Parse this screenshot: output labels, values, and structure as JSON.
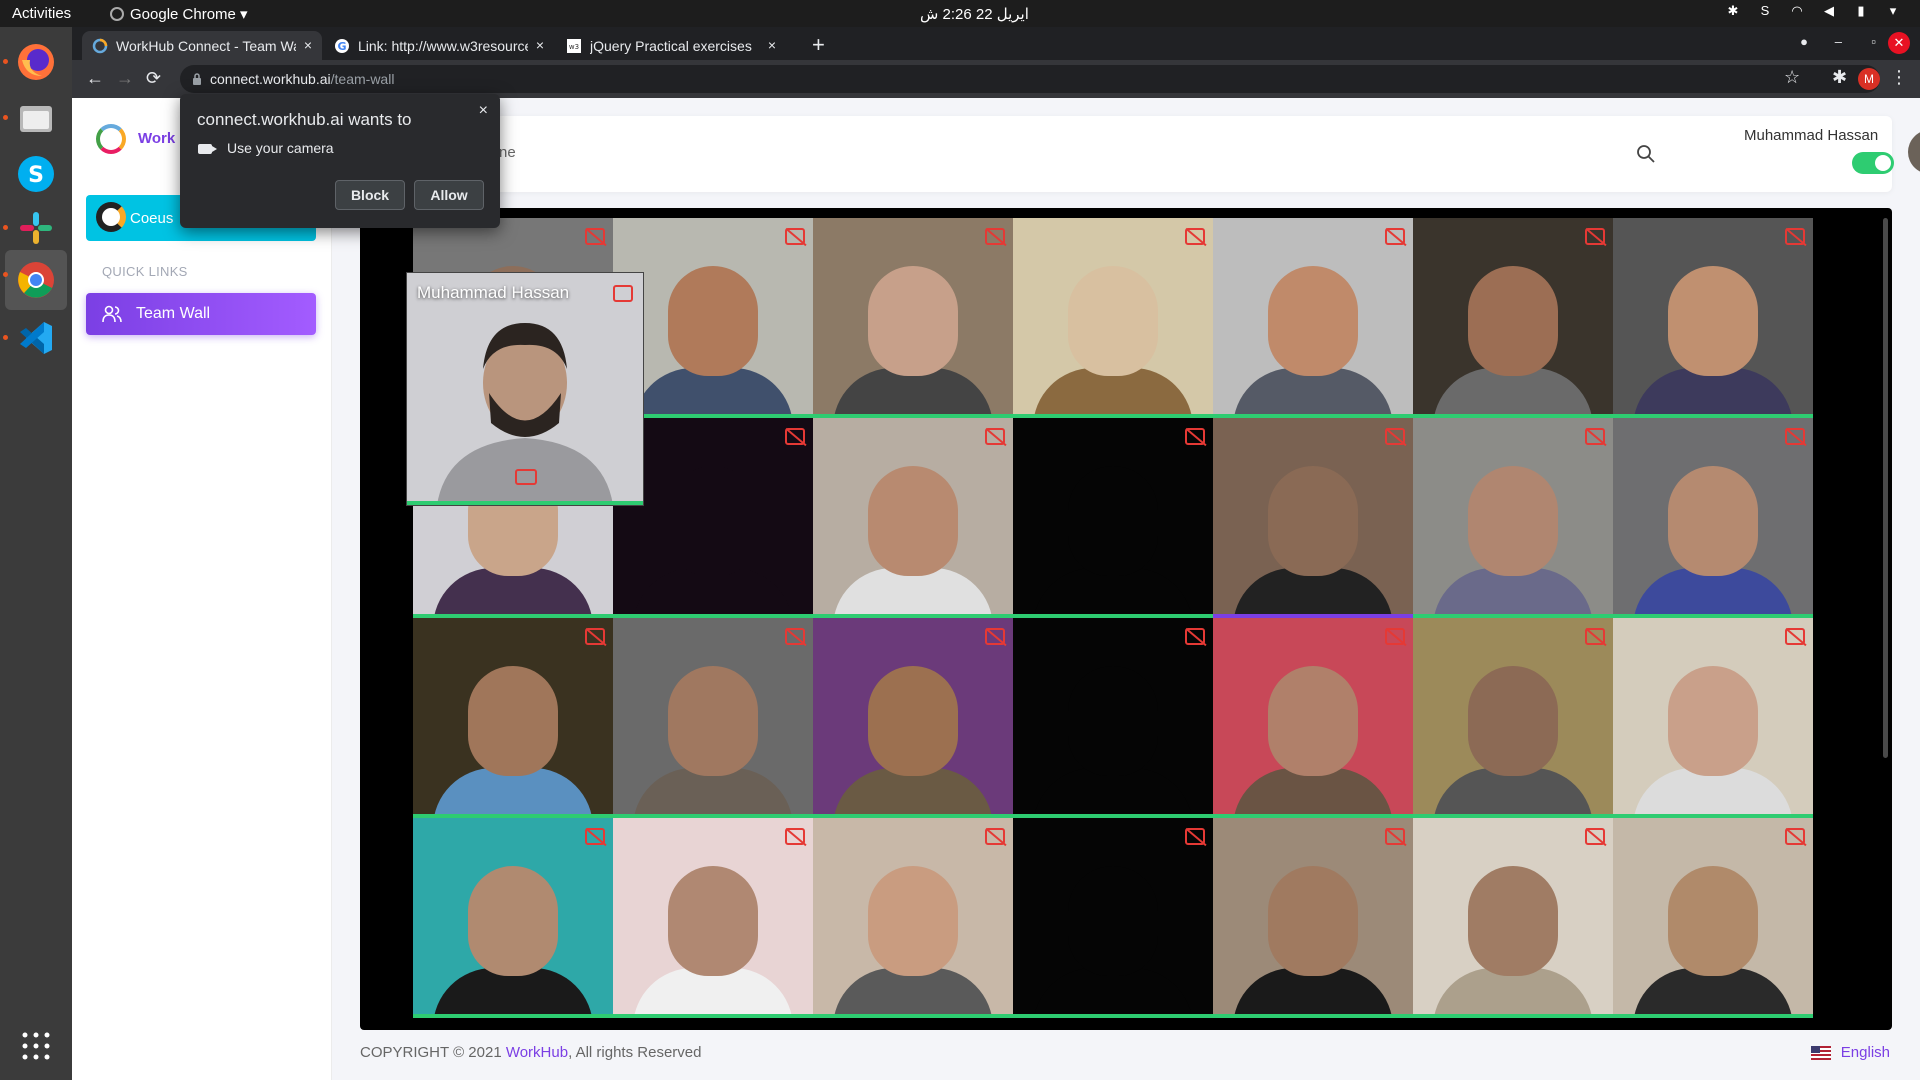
{
  "topbar": {
    "activities": "Activities",
    "app_menu": "Google Chrome ▾",
    "clock": "ایریل 22  2:26 ش"
  },
  "dock": {
    "items": [
      "firefox-icon",
      "files-icon",
      "skype-icon",
      "slack-icon",
      "chrome-icon",
      "vscode-icon",
      "app-grid-icon"
    ]
  },
  "tabs": [
    {
      "title": "WorkHub Connect - Team Wall",
      "close": "×"
    },
    {
      "title": "Link: http://www.w3resource",
      "close": "×"
    },
    {
      "title": "jQuery Practical exercises",
      "close": "×"
    }
  ],
  "new_tab": "+",
  "window_controls": {
    "minimize": "–",
    "maximize": "▫",
    "close": "✕"
  },
  "addressbar": {
    "back": "←",
    "forward": "→",
    "reload": "⟳",
    "host": "connect.workhub.ai",
    "path": "/team-wall",
    "star": "☆",
    "extensions": "✱",
    "profile": "M",
    "menu": "⋮"
  },
  "sidebar": {
    "logo_text": "Work",
    "company": "Coeus",
    "quick_links": "QUICK LINKS",
    "team_wall": "Team Wall"
  },
  "header": {
    "crumb": "ne",
    "user_name": "Muhammad Hassan",
    "toggle_on": true
  },
  "permission_popup": {
    "title": "connect.workhub.ai wants to",
    "request": "Use your camera",
    "block": "Block",
    "allow": "Allow",
    "close": "×"
  },
  "video_wall": {
    "self_name": "Muhammad Hassan",
    "rows": 4,
    "cols": 7,
    "tiles": [
      {
        "bg": "#777",
        "skin": "#8d6e5a",
        "shirt": "#6a6a6a",
        "bar": "#2ecc71"
      },
      {
        "bg": "#b8b8b0",
        "skin": "#b07a5a",
        "shirt": "#40506c",
        "bar": "#2ecc71"
      },
      {
        "bg": "#8c7a66",
        "skin": "#c7a08a",
        "shirt": "#444",
        "bar": "#2ecc71"
      },
      {
        "bg": "#d4c8a8",
        "skin": "#d8c0a0",
        "shirt": "#8b6a40",
        "bar": "#2ecc71"
      },
      {
        "bg": "#bdbdbd",
        "skin": "#c08a6a",
        "shirt": "#555a66",
        "bar": "#2ecc71"
      },
      {
        "bg": "#3a342c",
        "skin": "#9c6e54",
        "shirt": "#6a6a6a",
        "bar": "#2ecc71"
      },
      {
        "bg": "#555",
        "skin": "#c09070",
        "shirt": "#3d3a5c",
        "bar": "#2ecc71"
      },
      {
        "bg": "#d0cfd4",
        "skin": "#c9a58a",
        "shirt": "#44304e",
        "bar": "#2ecc71"
      },
      {
        "bg": "#140a14",
        "skin": "#140a14",
        "shirt": "#140a14",
        "bar": "#2ecc71"
      },
      {
        "bg": "#b7ada2",
        "skin": "#b88a70",
        "shirt": "#e0e0e0",
        "bar": "#2ecc71"
      },
      {
        "bg": "#050505",
        "skin": "#050505",
        "shirt": "#050505",
        "bar": "#2ecc71"
      },
      {
        "bg": "#7a6252",
        "skin": "#8a6a55",
        "shirt": "#222",
        "bar": "#7b3fe4"
      },
      {
        "bg": "#8c8c88",
        "skin": "#b08670",
        "shirt": "#6a6a8a",
        "bar": "#2ecc71"
      },
      {
        "bg": "#6e6e70",
        "skin": "#b58a70",
        "shirt": "#3d4a9c",
        "bar": "#2ecc71"
      },
      {
        "bg": "#3a3220",
        "skin": "#a0765a",
        "shirt": "#5a90c0",
        "bar": "#2ecc71"
      },
      {
        "bg": "#6a6a6a",
        "skin": "#a07860",
        "shirt": "#6a6056",
        "bar": "#2ecc71"
      },
      {
        "bg": "#6b3a7a",
        "skin": "#9c7050",
        "shirt": "#6a5a44",
        "bar": "#2ecc71"
      },
      {
        "bg": "#050505",
        "skin": "#050505",
        "shirt": "#050505",
        "bar": "#2ecc71"
      },
      {
        "bg": "#c84858",
        "skin": "#b0806a",
        "shirt": "#6a5444",
        "bar": "#2ecc71"
      },
      {
        "bg": "#9c8a5a",
        "skin": "#8c6a55",
        "shirt": "#555",
        "bar": "#2ecc71"
      },
      {
        "bg": "#d4ccbc",
        "skin": "#c9a08a",
        "shirt": "#dcdcdc",
        "bar": "#2ecc71"
      },
      {
        "bg": "#2ea8a8",
        "skin": "#b08a70",
        "shirt": "#1a1a1a",
        "bar": "#2ecc71"
      },
      {
        "bg": "#e8d4d4",
        "skin": "#b08872",
        "shirt": "#f0f0f0",
        "bar": "#2ecc71"
      },
      {
        "bg": "#c8b8a8",
        "skin": "#c99c80",
        "shirt": "#5a5a5a",
        "bar": "#2ecc71"
      },
      {
        "bg": "#050505",
        "skin": "#050505",
        "shirt": "#050505",
        "bar": "#2ecc71"
      },
      {
        "bg": "#9c8a78",
        "skin": "#a07a60",
        "shirt": "#1a1a1a",
        "bar": "#2ecc71"
      },
      {
        "bg": "#d8d0c4",
        "skin": "#a07c64",
        "shirt": "#aca08c",
        "bar": "#2ecc71"
      },
      {
        "bg": "#c4b8a8",
        "skin": "#b08a6a",
        "shirt": "#2a2a2a",
        "bar": "#2ecc71"
      }
    ]
  },
  "footer": {
    "copyright_prefix": "COPYRIGHT © 2021 ",
    "brand": "WorkHub",
    "copyright_suffix": ", All rights Reserved",
    "language": "English"
  },
  "colors": {
    "accent": "#7b3fe4",
    "active_green": "#2ecc71",
    "camera_off_red": "#e53935",
    "company_cyan": "#00c3e3"
  }
}
